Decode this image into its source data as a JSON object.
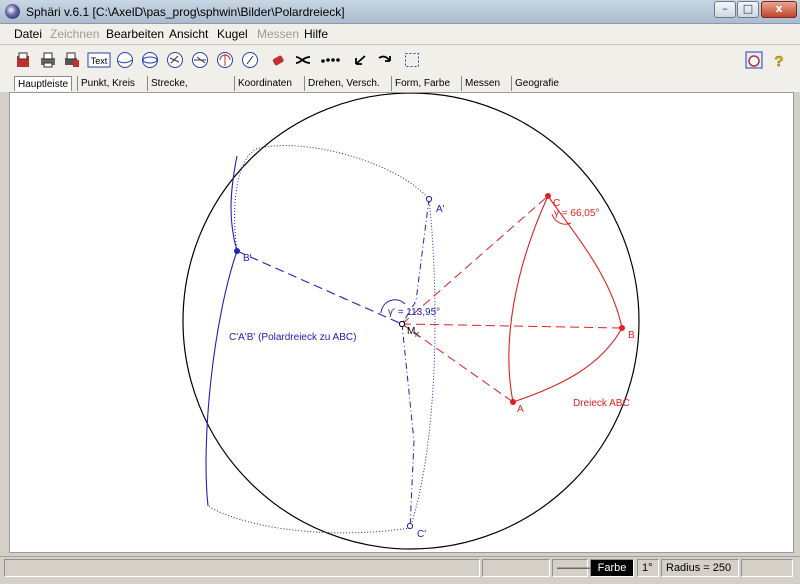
{
  "window": {
    "title": "Sphäri v.6.1   [C:\\AxelD\\pas_prog\\sphwin\\Bilder\\Polardreieck]",
    "minimize_label": "–",
    "maximize_label": "□",
    "close_label": "x"
  },
  "menu": [
    "Datei",
    "Zeichnen",
    "Bearbeiten",
    "Ansicht",
    "Kugel",
    "Messen",
    "Hilfe"
  ],
  "toolbar": {
    "text_button_label": "Text",
    "help_label": "?"
  },
  "tabs": [
    "Hauptleiste",
    "Punkt, Kreis",
    "Strecke, Dreieck",
    "Koordinaten",
    "Drehen, Versch.",
    "Form, Farbe",
    "Messen",
    "Geografie"
  ],
  "drawing": {
    "points": {
      "A": "A",
      "B": "B",
      "C": "C",
      "A_polar": "A'",
      "B_polar": "B'",
      "C_polar": "C'",
      "center": "M",
      "center_sub": "K"
    },
    "angle_gamma": "γ = 66,05°",
    "angle_gamma_polar": "γ' = 113,95°",
    "label_polar_triangle": "C'A'B' (Polardreieck zu ABC)",
    "label_triangle": "Dreieck ABC",
    "colors": {
      "red": "#e02020",
      "blue": "#2020c0",
      "black": "#000000"
    }
  },
  "status": {
    "line_style": "———",
    "color_label": "Farbe",
    "step": "1°",
    "radius": "Radius = 250"
  }
}
